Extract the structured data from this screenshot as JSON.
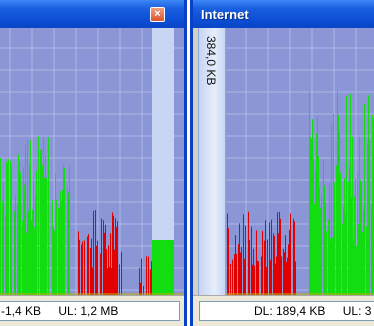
{
  "left_window": {
    "title": "",
    "close_glyph": "×",
    "status": {
      "dl": "1,4 KB",
      "ul": "UL: 1,2 MB",
      "dl_prefix": "-"
    }
  },
  "right_window": {
    "title": "Internet",
    "scale_label": "384,0 KB",
    "status": {
      "dl": "DL: 189,4 KB",
      "ul": "UL: 3"
    }
  },
  "colors": {
    "upload": "#e00000",
    "download": "#11dd11",
    "graph_bg": "#8a96d6",
    "grid": "#b0b8e6"
  }
}
